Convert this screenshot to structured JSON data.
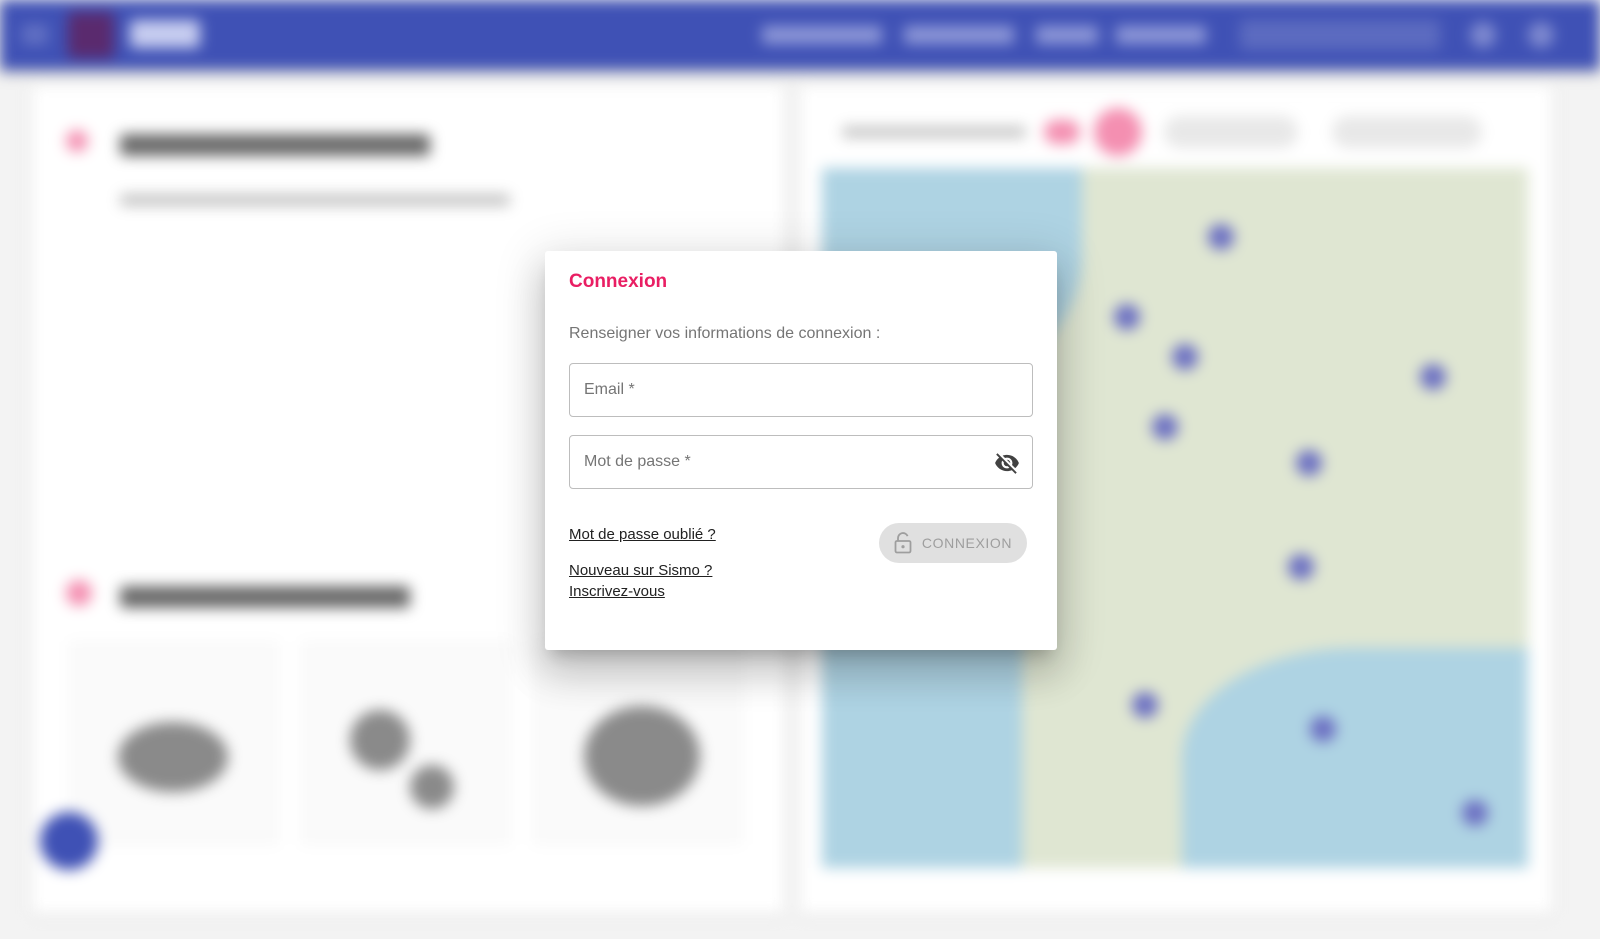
{
  "dialog": {
    "title": "Connexion",
    "subtitle": "Renseigner vos informations de connexion :",
    "email_placeholder": "Email *",
    "email_value": "",
    "password_placeholder": "Mot de passe *",
    "password_value": "",
    "forgot_password_link": "Mot de passe oublié ?",
    "new_user_text": "Nouveau sur Sismo ?",
    "signup_link": "Inscrivez-vous",
    "login_button_label": "CONNEXION",
    "login_button_state": "disabled"
  },
  "colors": {
    "accent": "#e91e63",
    "primary": "#3f51b5",
    "disabled_bg": "#e0e0e0",
    "disabled_text": "#9e9e9e"
  },
  "icons": [
    "visibility-off-icon",
    "lock-open-icon"
  ]
}
